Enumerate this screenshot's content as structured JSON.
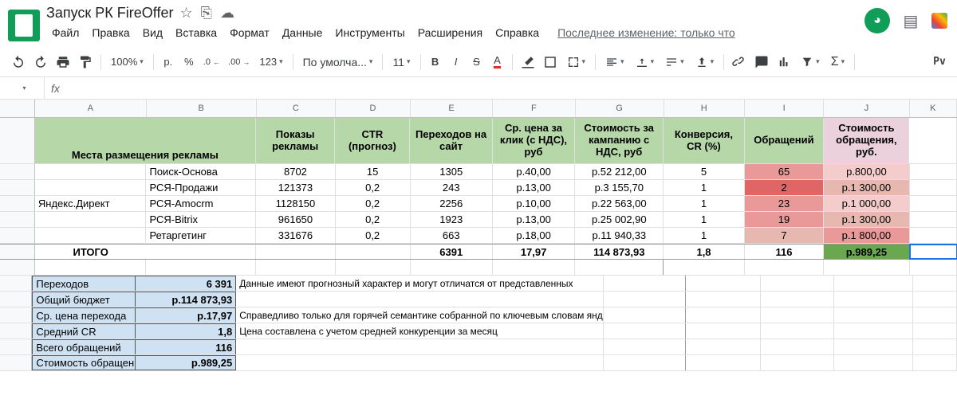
{
  "doc_title": "Запуск РК FireOffer",
  "menubar": [
    "Файл",
    "Правка",
    "Вид",
    "Вставка",
    "Формат",
    "Данные",
    "Инструменты",
    "Расширения",
    "Справка"
  ],
  "last_edit": "Последнее изменение: только что",
  "toolbar": {
    "zoom": "100%",
    "currency": "р.",
    "pct": "%",
    "dec_dec": ".0",
    "dec_inc": ".00",
    "num_fmt": "123",
    "font": "По умолча...",
    "size": "11",
    "bold": "B",
    "italic": "I",
    "strike": "S",
    "color": "A",
    "pv": "Pv"
  },
  "fx_label": "fx",
  "cols": [
    "A",
    "B",
    "C",
    "D",
    "E",
    "F",
    "G",
    "H",
    "I",
    "J",
    "K"
  ],
  "header_row": {
    "A": "Места размещения рекламы",
    "C": "Показы рекламы",
    "D": "CTR (прогноз)",
    "E": "Переходов на сайт",
    "F": "Ср. цена за клик (с НДС), руб",
    "G": "Стоимость за кампанию с НДС, руб",
    "H": "Конверсия, CR (%)",
    "I": "Обращений",
    "J": "Стоимость обращения, руб."
  },
  "group_label": "Яндекс.Директ",
  "data_rows": [
    {
      "B": "Поиск-Основа",
      "C": "8702",
      "D": "15",
      "E": "1305",
      "F": "р.40,00",
      "G": "р.52 212,00",
      "H": "5",
      "I": "65",
      "J": "р.800,00",
      "Icls": "cell-red1",
      "Jcls": "cell-red3"
    },
    {
      "B": "РСЯ-Продажи",
      "C": "121373",
      "D": "0,2",
      "E": "243",
      "F": "р.13,00",
      "G": "р.3 155,70",
      "H": "1",
      "I": "2",
      "J": "р.1 300,00",
      "Icls": "cell-red4",
      "Jcls": "cell-red2"
    },
    {
      "B": "РСЯ-Amocrm",
      "C": "1128150",
      "D": "0,2",
      "E": "2256",
      "F": "р.10,00",
      "G": "р.22 563,00",
      "H": "1",
      "I": "23",
      "J": "р.1 000,00",
      "Icls": "cell-red1",
      "Jcls": "cell-red3"
    },
    {
      "B": "РСЯ-Bitrix",
      "C": "961650",
      "D": "0,2",
      "E": "1923",
      "F": "р.13,00",
      "G": "р.25 002,90",
      "H": "1",
      "I": "19",
      "J": "р.1 300,00",
      "Icls": "cell-red1",
      "Jcls": "cell-red2"
    },
    {
      "B": "Ретаргетинг",
      "C": "331676",
      "D": "0,2",
      "E": "663",
      "F": "р.18,00",
      "G": "р.11 940,33",
      "H": "1",
      "I": "7",
      "J": "р.1 800,00",
      "Icls": "cell-red2",
      "Jcls": "cell-red1"
    }
  ],
  "total": {
    "label": "ИТОГО",
    "E": "6391",
    "F": "17,97",
    "G": "114 873,93",
    "H": "1,8",
    "I": "116",
    "J": "р.989,25"
  },
  "summary": [
    {
      "k": "Переходов",
      "v": "6 391"
    },
    {
      "k": "Общий бюджет",
      "v": "р.114 873,93"
    },
    {
      "k": "Ср. цена перехода",
      "v": "р.17,97"
    },
    {
      "k": "Средний CR",
      "v": "1,8"
    },
    {
      "k": "Всего обращений",
      "v": "116"
    },
    {
      "k": "Стоимость обращен",
      "v": "р.989,25"
    }
  ],
  "notes": [
    "Данные имеют прогнозный характер и могут отличатся от представленных",
    "Справедливо только для горячей семантике собранной по ключевым словам яндекса без учета минус слов и дополнительных тематик",
    "Цена составлена с учетом средней конкуренции за месяц"
  ],
  "chart_data": {
    "type": "table",
    "title": "Запуск РК FireOffer — Яндекс.Директ",
    "columns": [
      "Места размещения рекламы",
      "Показы рекламы",
      "CTR (прогноз)",
      "Переходов на сайт",
      "Ср. цена за клик (с НДС), руб",
      "Стоимость за кампанию с НДС, руб",
      "Конверсия, CR (%)",
      "Обращений",
      "Стоимость обращения, руб."
    ],
    "rows": [
      [
        "Поиск-Основа",
        8702,
        15,
        1305,
        40.0,
        52212.0,
        5,
        65,
        800.0
      ],
      [
        "РСЯ-Продажи",
        121373,
        0.2,
        243,
        13.0,
        3155.7,
        1,
        2,
        1300.0
      ],
      [
        "РСЯ-Amocrm",
        1128150,
        0.2,
        2256,
        10.0,
        22563.0,
        1,
        23,
        1000.0
      ],
      [
        "РСЯ-Bitrix",
        961650,
        0.2,
        1923,
        13.0,
        25002.9,
        1,
        19,
        1300.0
      ],
      [
        "Ретаргетинг",
        331676,
        0.2,
        663,
        18.0,
        11940.33,
        1,
        7,
        1800.0
      ]
    ],
    "totals": {
      "Переходов на сайт": 6391,
      "Ср. цена за клик": 17.97,
      "Стоимость за кампанию": 114873.93,
      "Конверсия": 1.8,
      "Обращений": 116,
      "Стоимость обращения": 989.25
    }
  }
}
